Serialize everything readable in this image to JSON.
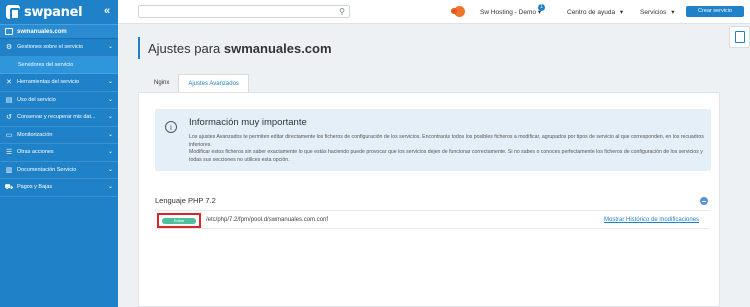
{
  "app": {
    "name": "swpanel",
    "collapse_icon": "«"
  },
  "sidebar": {
    "domain": "swmanuales.com",
    "items": [
      {
        "label": "Gestiones sobre el servicio",
        "chevron": "⌄"
      },
      {
        "label": "Servidores del servicio",
        "chevron": ""
      },
      {
        "label": "Herramientas del servicio",
        "chevron": "⌄"
      },
      {
        "label": "Uso del servicio",
        "chevron": "⌄"
      },
      {
        "label": "Conservar y recuperar mis dat...",
        "chevron": "⌄"
      },
      {
        "label": "Monitorización",
        "chevron": "⌄"
      },
      {
        "label": "Otras acciones",
        "chevron": "⌄"
      },
      {
        "label": "Documentación Servicio",
        "chevron": "⌄"
      },
      {
        "label": "Pagos y Bajas",
        "chevron": "⌄"
      }
    ]
  },
  "topbar": {
    "search_placeholder": "",
    "search_icon": "⚲",
    "account": "Sw Hosting - Demo",
    "account_badge": "1",
    "account_caret": "▾",
    "help": "Centro de ayuda",
    "help_caret": "▾",
    "services": "Servicios",
    "services_caret": "▾",
    "create_service": "Crear servicio"
  },
  "page": {
    "title": "Ajustes para ",
    "title_domain": "swmanuales.com"
  },
  "tabs": [
    {
      "label": "Nginx"
    },
    {
      "label": "Ajustes Avanzados"
    }
  ],
  "info": {
    "icon": "i",
    "title": "Información muy importante",
    "line1": "Los ajustes Avanzados te permiten editar directamente los ficheros de configuración de los servicios. Encontrarás todos los posibles ficheros a modificar, agrupados por tipos de servicio al que corresponden, en los recuadros inferiores.",
    "line2": "Modificar estos ficheros sin saber exactamente lo que estás haciendo puede provocar que los servicios dejen de funcionar correctamente. Si no sabes o conoces perfectamente los ficheros de configuración de los servicios y todas sus secciones no utilices esta opción."
  },
  "php": {
    "title": "Lenguaje PHP 7.2",
    "edit_label": "Editar",
    "path": "/etc/php/7.2/fpm/pool.d/swmanuales.com.conf",
    "history_link": "Mostrar Histórico de modificaciones"
  },
  "colors": {
    "brand": "#1f82c8",
    "edit_button": "#4ec09a",
    "highlight": "#d9262b"
  }
}
